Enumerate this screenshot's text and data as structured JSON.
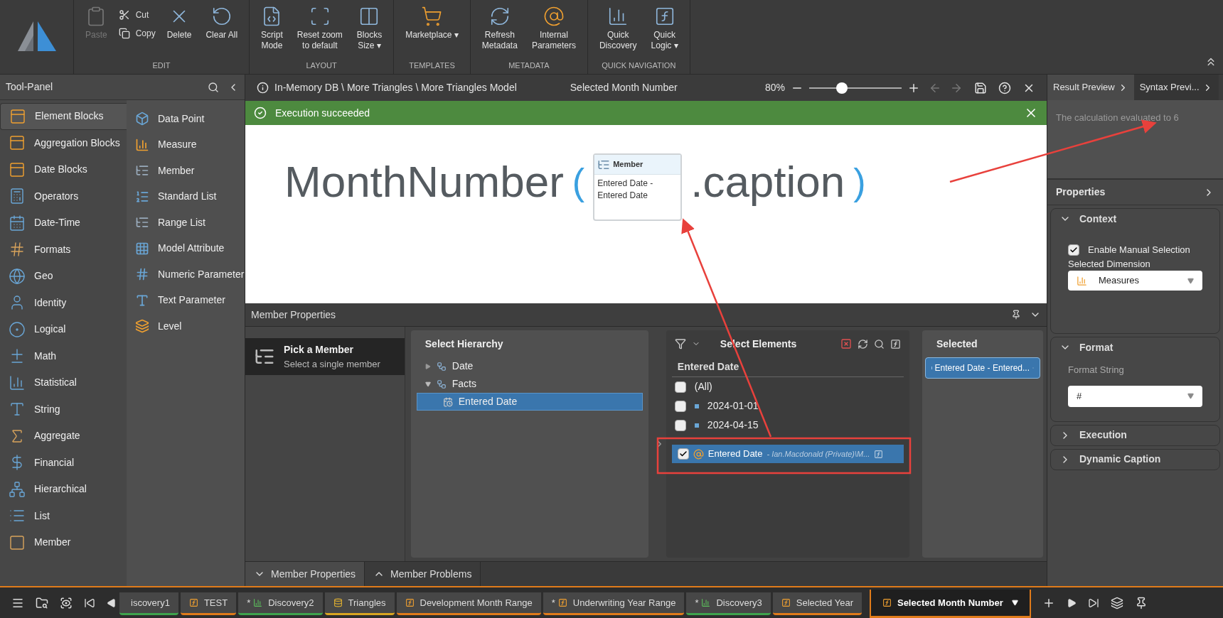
{
  "toolbar": {
    "groups": [
      {
        "label": "EDIT",
        "buttons": [
          {
            "label": "Paste",
            "disabled": true,
            "kind": "large"
          },
          {
            "label": "Cut",
            "disabled": false,
            "kind": "compact"
          },
          {
            "label": "Copy",
            "disabled": false,
            "kind": "compact"
          },
          {
            "label": "Delete",
            "disabled": false,
            "kind": "large"
          },
          {
            "label": "Clear All",
            "disabled": false,
            "kind": "large"
          }
        ]
      },
      {
        "label": "LAYOUT",
        "buttons": [
          {
            "label": "Script\nMode",
            "disabled": false,
            "kind": "large"
          },
          {
            "label": "Reset zoom\nto default",
            "disabled": false,
            "kind": "large"
          },
          {
            "label": "Blocks\nSize ▾",
            "disabled": false,
            "kind": "large"
          }
        ]
      },
      {
        "label": "TEMPLATES",
        "buttons": [
          {
            "label": "Marketplace ▾",
            "disabled": false,
            "kind": "large"
          }
        ]
      },
      {
        "label": "METADATA",
        "buttons": [
          {
            "label": "Refresh\nMetadata",
            "disabled": false,
            "kind": "large"
          },
          {
            "label": "Internal\nParameters",
            "disabled": false,
            "kind": "large"
          }
        ]
      },
      {
        "label": "QUICK NAVIGATION",
        "buttons": [
          {
            "label": "Quick\nDiscovery",
            "disabled": false,
            "kind": "large"
          },
          {
            "label": "Quick\nLogic ▾",
            "disabled": false,
            "kind": "large"
          }
        ]
      }
    ]
  },
  "tool_panel": {
    "title": "Tool-Panel",
    "categories": [
      {
        "label": "Element Blocks",
        "selected": true
      },
      {
        "label": "Aggregation Blocks",
        "selected": false
      },
      {
        "label": "Date Blocks",
        "selected": false
      },
      {
        "label": "Operators",
        "selected": false
      },
      {
        "label": "Date-Time",
        "selected": false
      },
      {
        "label": "Formats",
        "selected": false
      },
      {
        "label": "Geo",
        "selected": false
      },
      {
        "label": "Identity",
        "selected": false
      },
      {
        "label": "Logical",
        "selected": false
      },
      {
        "label": "Math",
        "selected": false
      },
      {
        "label": "Statistical",
        "selected": false
      },
      {
        "label": "String",
        "selected": false
      },
      {
        "label": "Aggregate",
        "selected": false
      },
      {
        "label": "Financial",
        "selected": false
      },
      {
        "label": "Hierarchical",
        "selected": false
      },
      {
        "label": "List",
        "selected": false
      },
      {
        "label": "Member",
        "selected": false
      }
    ],
    "items": [
      "Data Point",
      "Measure",
      "Member",
      "Standard List",
      "Range List",
      "Model Attribute",
      "Numeric Parameter",
      "Text Parameter",
      "Level"
    ]
  },
  "editor": {
    "breadcrumb": "In-Memory DB \\ More Triangles \\ More Triangles Model",
    "title": "Selected Month Number",
    "zoom": "80%",
    "zoom_slider": {
      "level": 0.35
    },
    "banner": "Execution succeeded",
    "formula": {
      "function": "MonthNumber",
      "open": "(",
      "block": {
        "title": "Member",
        "text": "Entered Date - Entered Date"
      },
      "property": ".caption",
      "close": ")"
    }
  },
  "member_properties": {
    "title": "Member Properties",
    "modes": [
      {
        "title": "Pick a Member",
        "subtitle": "Select a single member",
        "selected": true
      }
    ],
    "hierarchy": {
      "title": "Select Hierarchy",
      "tree": [
        {
          "label": "Date",
          "expanded": false,
          "selected": false
        },
        {
          "label": "Facts",
          "expanded": true,
          "selected": false,
          "children": [
            {
              "label": "Entered Date",
              "selected": true
            }
          ]
        }
      ]
    },
    "elements": {
      "title": "Select Elements",
      "column": "Entered Date",
      "items": [
        {
          "label": "(All)",
          "checked": false,
          "kind": "all"
        },
        {
          "label": "2024-01-01",
          "checked": false,
          "kind": "member"
        },
        {
          "label": "2024-04-15",
          "checked": false,
          "kind": "member"
        }
      ],
      "dragged": {
        "label": "Entered Date",
        "detail": "- Ian.Macdonald (Private)\\M...",
        "checked": true
      }
    },
    "selected": {
      "title": "Selected",
      "chips": [
        "Entered Date - Entered..."
      ]
    },
    "tabs": [
      {
        "label": "Member Properties",
        "selected": true
      },
      {
        "label": "Member Problems",
        "selected": false
      }
    ]
  },
  "right_panel": {
    "tabs": [
      {
        "label": "Result Preview",
        "selected": true
      },
      {
        "label": "Syntax Previ...",
        "selected": false
      }
    ],
    "result": "The calculation evaluated to 6",
    "properties_title": "Properties",
    "sections": [
      {
        "title": "Context",
        "expanded": true,
        "kind": "context",
        "checkbox": {
          "label": "Enable Manual Selection",
          "checked": true
        },
        "field_label": "Selected Dimension",
        "value": "Measures"
      },
      {
        "title": "Format",
        "expanded": true,
        "kind": "format",
        "field_label": "Format String",
        "value": "#"
      },
      {
        "title": "Execution",
        "expanded": false
      },
      {
        "title": "Dynamic Caption",
        "expanded": false
      }
    ]
  },
  "taskbar": {
    "tabs": [
      {
        "label": "iscovery1",
        "kind": "cut",
        "color": "#3fa34d",
        "selected": false
      },
      {
        "label": "TEST",
        "kind": "logic",
        "color": "#e07b1a",
        "selected": false
      },
      {
        "label": "Discovery2",
        "kind": "discovery",
        "color": "#3fa34d",
        "marker": "*",
        "selected": false
      },
      {
        "label": "Triangles",
        "kind": "model",
        "color": "#d9a521",
        "selected": false
      },
      {
        "label": "Development Month Range",
        "kind": "logic",
        "color": "#e07b1a",
        "selected": false
      },
      {
        "label": "Underwriting Year Range",
        "kind": "logic",
        "color": "#e07b1a",
        "marker": "*",
        "selected": false
      },
      {
        "label": "Discovery3",
        "kind": "discovery",
        "color": "#3fa34d",
        "marker": "*",
        "selected": false
      },
      {
        "label": "Selected Year",
        "kind": "logic",
        "color": "#e07b1a",
        "selected": false
      },
      {
        "label": "Selected Month Number",
        "kind": "logic",
        "color": "#e07b1a",
        "selected": true
      }
    ]
  }
}
